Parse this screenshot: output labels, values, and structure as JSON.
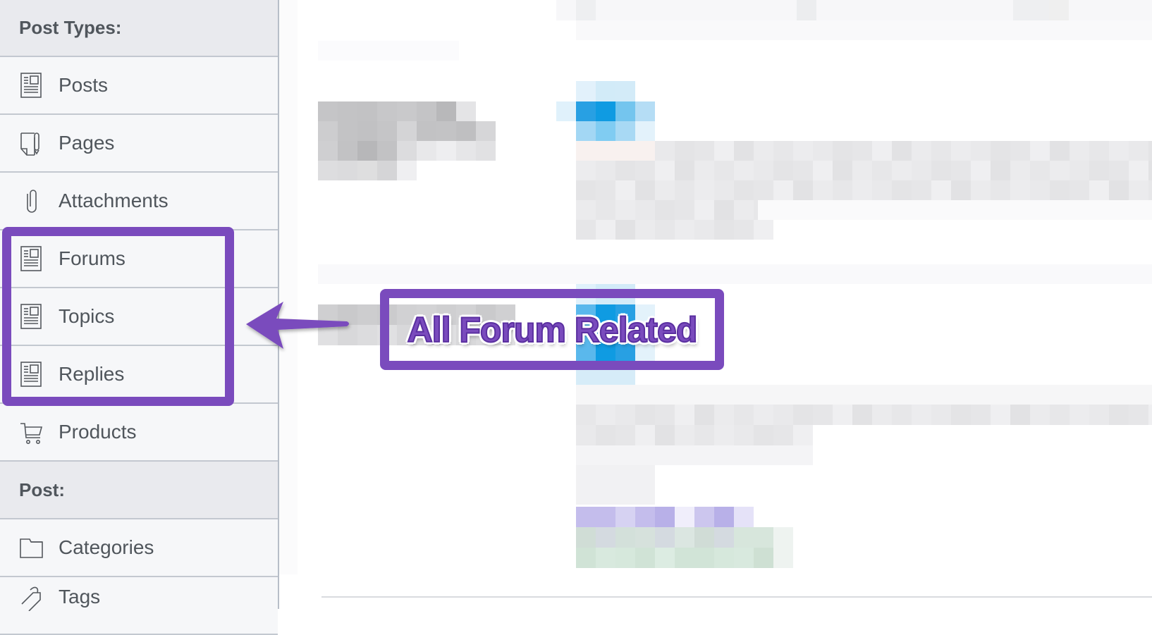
{
  "sidebar": {
    "rows": [
      {
        "type": "section",
        "label": "Post Types:"
      },
      {
        "type": "item",
        "label": "Posts",
        "icon": "post-icon"
      },
      {
        "type": "item",
        "label": "Pages",
        "icon": "page-icon"
      },
      {
        "type": "item",
        "label": "Attachments",
        "icon": "paperclip-icon"
      },
      {
        "type": "item",
        "label": "Forums",
        "icon": "post-icon"
      },
      {
        "type": "item",
        "label": "Topics",
        "icon": "post-icon"
      },
      {
        "type": "item",
        "label": "Replies",
        "icon": "post-icon"
      },
      {
        "type": "item",
        "label": "Products",
        "icon": "cart-icon"
      },
      {
        "type": "section",
        "label": "Post:"
      },
      {
        "type": "item",
        "label": "Categories",
        "icon": "folder-icon"
      },
      {
        "type": "item",
        "label": "Tags",
        "icon": "tag-icon"
      }
    ]
  },
  "annotation": {
    "callout_text": "All Forum Related",
    "highlighted_items": [
      "Forums",
      "Topics",
      "Replies"
    ],
    "accent_color": "#7a4bbd"
  },
  "main": {
    "content_state": "pixelated / obscured"
  }
}
